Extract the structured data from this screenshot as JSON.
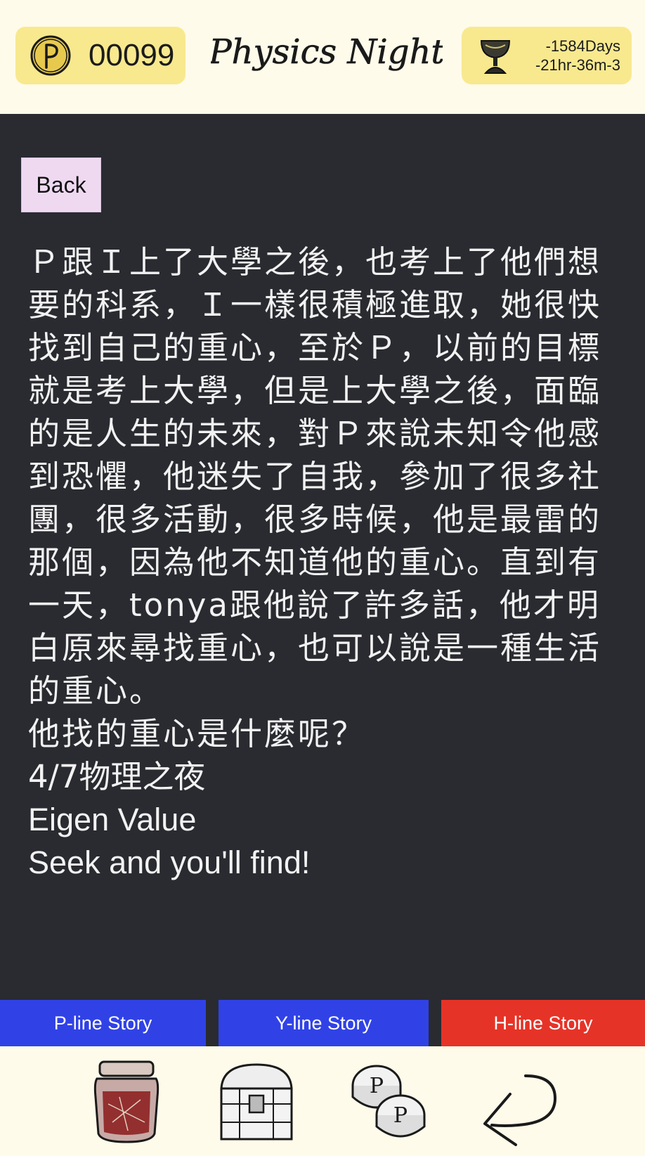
{
  "header": {
    "coins": "00099",
    "title": "Physics Night",
    "timer_days": "-1584Days",
    "timer_time": "-21hr-36m-3"
  },
  "main": {
    "back_label": "Back",
    "story_paragraph": "Ｐ跟Ｉ上了大學之後，也考上了他們想要的科系，Ｉ一樣很積極進取，她很快找到自己的重心，至於Ｐ，以前的目標就是考上大學，但是上大學之後，面臨的是人生的未來，對Ｐ來說未知令他感到恐懼，他迷失了自我，參加了很多社團，很多活動，很多時候，他是最雷的那個，因為他不知道他的重心。直到有一天，tonya跟他說了許多話，他才明白原來尋找重心，也可以說是一種生活的重心。",
    "story_question": "他找的重心是什麼呢？",
    "story_event": "4/7物理之夜",
    "story_eigen": "Eigen Value",
    "story_slogan": "Seek and you'll find!"
  },
  "tabs": {
    "p_line": "P-line Story",
    "y_line": "Y-line Story",
    "h_line": "H-line Story"
  },
  "colors": {
    "header_bg": "#fefbea",
    "badge_bg": "#f8e98f",
    "content_bg": "#292b30",
    "tab_blue": "#3042e6",
    "tab_red": "#e63327",
    "back_bg": "#efd9f1"
  },
  "icons": {
    "coin": "coin-p-icon",
    "trophy": "trophy-icon",
    "jar": "jar-icon",
    "chest": "treasure-chest-icon",
    "coins": "coins-icon",
    "return": "return-arrow-icon"
  }
}
